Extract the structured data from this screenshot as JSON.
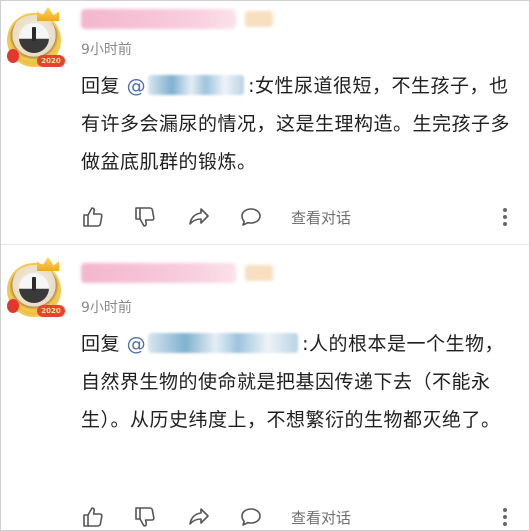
{
  "comments": [
    {
      "timestamp": "9小时前",
      "reply_prefix": "回复",
      "mention_at": "@",
      "colon": ":",
      "text": "女性尿道很短，不生孩子，也有许多会漏尿的情况，这是生理构造。生完孩子多做盆底肌群的锻炼。",
      "avatar_year": "2020",
      "actions": {
        "view_dialog_label": "查看对话"
      }
    },
    {
      "timestamp": "9小时前",
      "reply_prefix": "回复",
      "mention_at": "@",
      "colon": ":",
      "text": "人的根本是一个生物，自然界生物的使命就是把基因传递下去（不能永生）。从历史纬度上，不想繁衍的生物都灭绝了。",
      "avatar_year": "2020",
      "actions": {
        "view_dialog_label": "查看对话"
      }
    }
  ],
  "icons": {
    "like": "thumbs-up-icon",
    "dislike": "thumbs-down-icon",
    "share": "share-arrow-icon",
    "reply": "speech-bubble-icon",
    "more": "more-dots-icon"
  },
  "colors": {
    "mention": "#4a6fa5",
    "timestamp": "#8a8a8a",
    "action_text": "#6f6f6f",
    "username_blur": "#f3b6cd"
  }
}
